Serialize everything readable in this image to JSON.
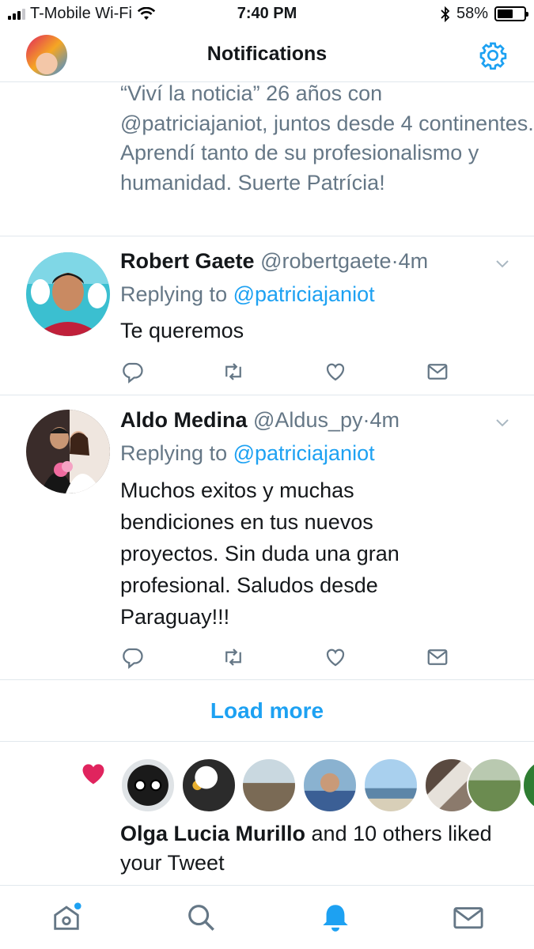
{
  "status_bar": {
    "carrier": "T-Mobile Wi-Fi",
    "time": "7:40 PM",
    "battery": "58%",
    "battery_level": 0.58
  },
  "header": {
    "title": "Notifications",
    "profile_icon": "avatar",
    "settings_icon": "gear-icon"
  },
  "feed": {
    "partial_tweet_text": "“Viví la noticia” 26 años con @patriciajaniot, juntos desde 4 continentes. Aprendí tanto de su profesionalismo y humanidad. Suerte Patrícia!",
    "tweets": [
      {
        "name": "Robert Gaete",
        "handle": "@robertgaete",
        "dot": "·",
        "ago": "4m",
        "reply_prefix": "Replying to ",
        "reply_to": "@patriciajaniot",
        "text": "Te queremos"
      },
      {
        "name": "Aldo Medina",
        "handle": "@Aldus_py",
        "dot": "·",
        "ago": "4m",
        "reply_prefix": "Replying to ",
        "reply_to": "@patriciajaniot",
        "text": "Muchos exitos y muchas bendiciones en tus nuevos proyectos. Sin duda una gran profesional. Saludos desde Paraguay!!!"
      }
    ],
    "load_more": "Load more",
    "like_notification": {
      "actor": "Olga Lucia Murillo",
      "rest": " and 10 others liked your Tweet"
    }
  },
  "tabs": [
    "home-icon",
    "search-icon",
    "notifications-icon",
    "messages-icon"
  ],
  "colors": {
    "accent": "#1da1f2",
    "like": "#e0245e",
    "secondary_text": "#657786",
    "divider": "#e1e8ed"
  }
}
